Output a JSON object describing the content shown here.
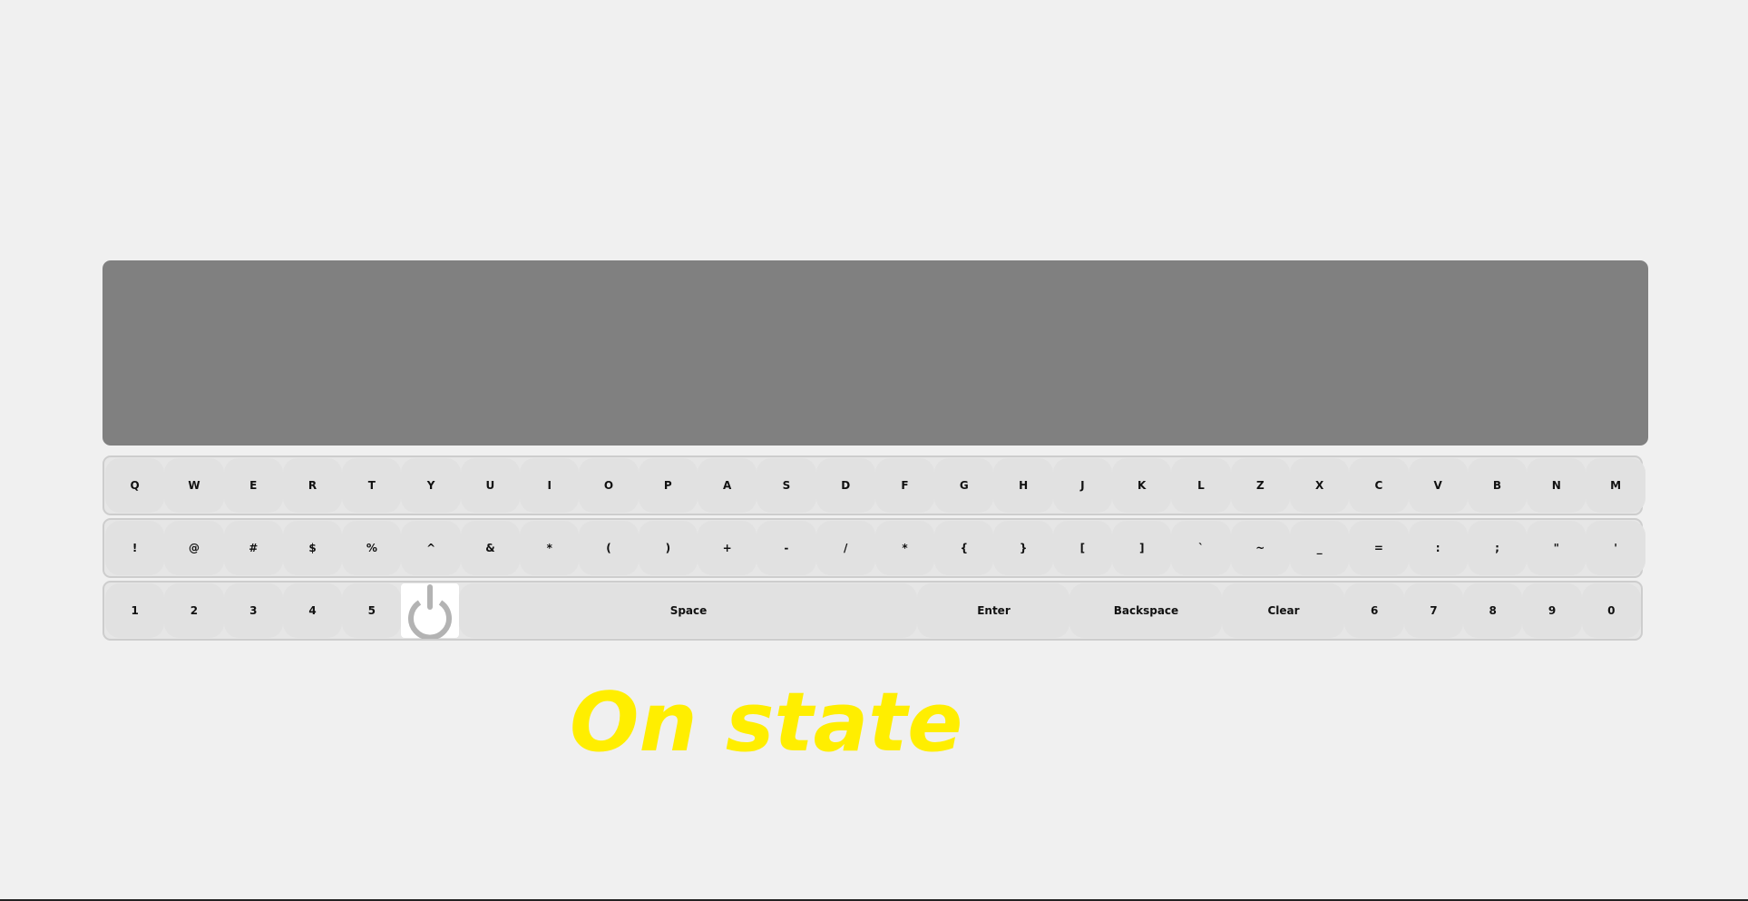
{
  "display": {
    "text": ""
  },
  "keyboard": {
    "row1": [
      "Q",
      "W",
      "E",
      "R",
      "T",
      "Y",
      "U",
      "I",
      "O",
      "P",
      "A",
      "S",
      "D",
      "F",
      "G",
      "H",
      "J",
      "K",
      "L",
      "Z",
      "X",
      "C",
      "V",
      "B",
      "N",
      "M"
    ],
    "row2": [
      "!",
      "@",
      "#",
      "$",
      "%",
      "^",
      "&",
      "*",
      "(",
      ")",
      "+",
      "-",
      "/",
      "*",
      "{",
      "}",
      "[",
      "]",
      "`",
      "~",
      "_",
      "=",
      ":",
      ";",
      "\"",
      "'"
    ],
    "row3_left": [
      "1",
      "2",
      "3",
      "4",
      "5"
    ],
    "space_label": "Space",
    "enter_label": "Enter",
    "backspace_label": "Backspace",
    "clear_label": "Clear",
    "row3_right": [
      "6",
      "7",
      "8",
      "9",
      "0"
    ],
    "power_icon": "power-icon"
  },
  "state": {
    "label": "On state",
    "color": "#ffee00"
  }
}
